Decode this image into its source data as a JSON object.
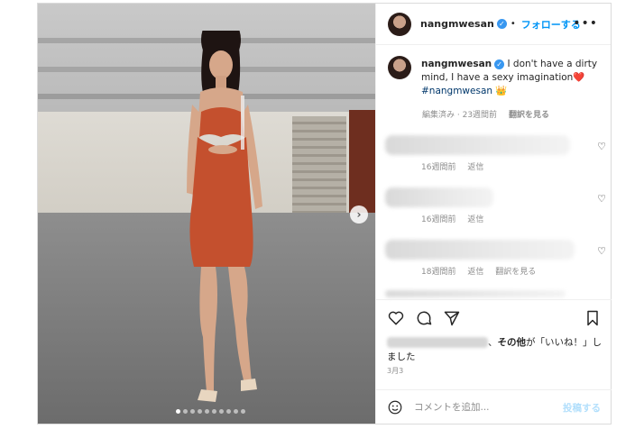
{
  "post": {
    "username": "nangmwesan",
    "follow_label": "フォローする",
    "caption_username": "nangmwesan",
    "caption_text": "I don't have a dirty mind, I have a sexy imagination❤️",
    "caption_hashtag": "#nangmwesan",
    "caption_emoji": "👑",
    "caption_meta_edited": "編集済み",
    "caption_meta_time": "23週間前",
    "caption_meta_translate": "翻訳を見る"
  },
  "comments": [
    {
      "time": "16週間前",
      "reply": "返信",
      "translate": ""
    },
    {
      "time": "16週間前",
      "reply": "返信",
      "translate": ""
    },
    {
      "time": "18週間前",
      "reply": "返信",
      "translate": "翻訳を見る"
    }
  ],
  "likes": {
    "suffix_bold": "その他",
    "suffix_text": "が「いいね！」しました"
  },
  "date": "3月3",
  "add_comment": {
    "placeholder": "コメントを追加...",
    "post_label": "投稿する"
  },
  "carousel": {
    "slide_count": 10,
    "active_index": 0
  },
  "colors": {
    "verified": "#3897f0",
    "follow": "#0095f6",
    "dress": "#c4502e"
  }
}
